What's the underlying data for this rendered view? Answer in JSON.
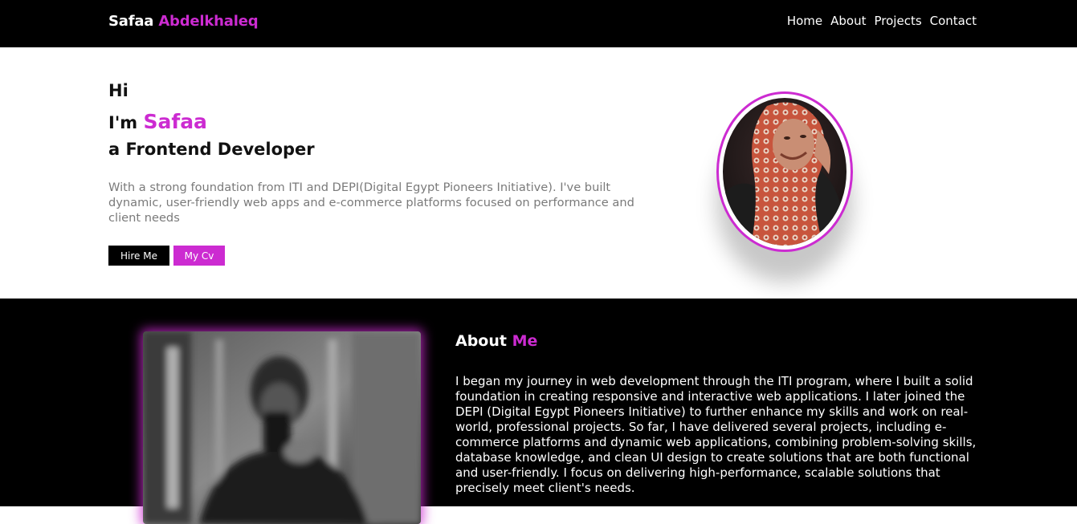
{
  "nav": {
    "brand_first": "Safaa",
    "brand_last": "Abdelkhaleq",
    "links": [
      "Home",
      "About",
      "Projects",
      "Contact"
    ]
  },
  "hero": {
    "line1": "Hi",
    "line2_prefix": "I'm",
    "line2_name": "Safaa",
    "line3": "a Frontend Developer",
    "description": "With a strong foundation from ITI and DEPI(Digital Egypt Pioneers Initiative). I've built dynamic, user-friendly web apps and e-commerce platforms focused on performance and client needs",
    "hire_label": "Hire Me",
    "cv_label": "My Cv"
  },
  "about": {
    "title_prefix": "About",
    "title_accent": "Me",
    "text": "I began my journey in web development through the ITI program, where I built a solid foundation in creating responsive and interactive web applications. I later joined the DEPI (Digital Egypt Pioneers Initiative) to further enhance my skills and work on real-world, professional projects. So far, I have delivered several projects, including e-commerce platforms and dynamic web applications, combining problem-solving skills, database knowledge, and clean UI design to create solutions that are both functional and user-friendly. I focus on delivering high-performance, scalable solutions that precisely meet client's needs."
  },
  "colors": {
    "accent": "#cc2bd1",
    "dark": "#000000",
    "light": "#ffffff",
    "muted": "#7a7a7a"
  }
}
